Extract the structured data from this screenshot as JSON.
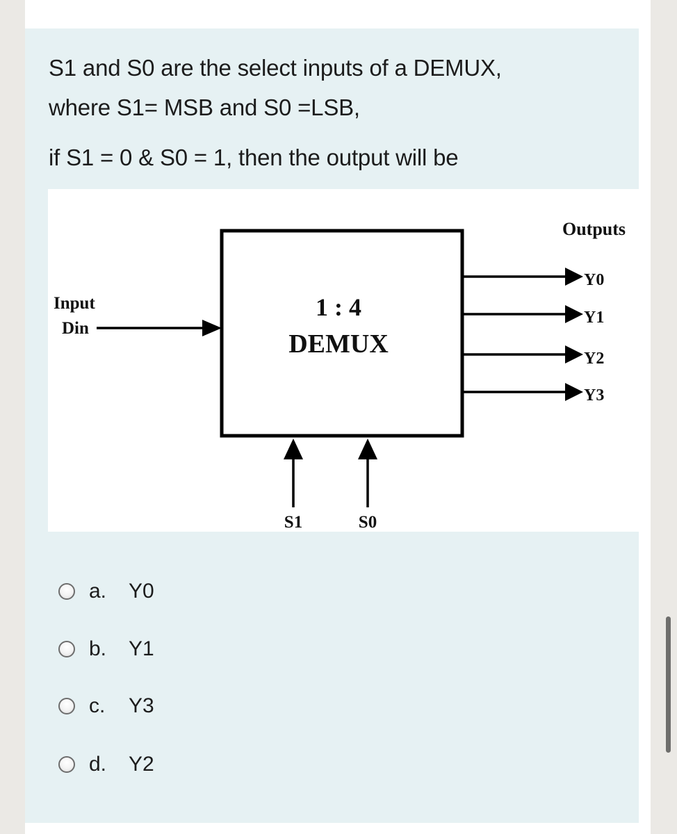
{
  "question": {
    "lines": [
      "S1 and S0 are the select inputs of a DEMUX,",
      "where S1= MSB and S0 =LSB,",
      "if S1 = 0 & S0 = 1, then the output will be"
    ]
  },
  "diagram": {
    "block_ratio": "1 : 4",
    "block_name": "DEMUX",
    "input_label_1": "Input",
    "input_label_2": "Din",
    "outputs_title": "Outputs",
    "outputs": [
      "Y0",
      "Y1",
      "Y2",
      "Y3"
    ],
    "select_inputs": [
      "S1",
      "S0"
    ]
  },
  "options": [
    {
      "letter": "a.",
      "text": "Y0",
      "selected": false
    },
    {
      "letter": "b.",
      "text": "Y1",
      "selected": false
    },
    {
      "letter": "c.",
      "text": "Y3",
      "selected": false
    },
    {
      "letter": "d.",
      "text": "Y2",
      "selected": false
    }
  ],
  "colors": {
    "page_bg": "#ebe9e5",
    "panel_bg": "#e6f1f3",
    "text": "#1c1c1c"
  }
}
